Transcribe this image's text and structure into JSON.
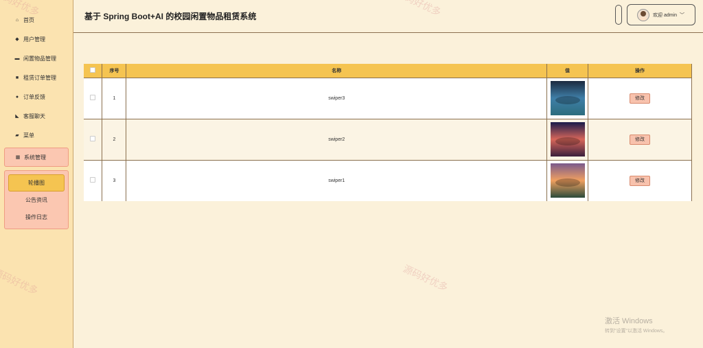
{
  "header": {
    "title": "基于 Spring Boot+AI 的校园闲置物品租赁系统",
    "welcome": "欢迎 admin"
  },
  "sidebar": {
    "items": [
      {
        "label": "首页",
        "icon": "home-icon"
      },
      {
        "label": "用户管理",
        "icon": "users-icon"
      },
      {
        "label": "闲置物品管理",
        "icon": "folder-icon"
      },
      {
        "label": "租赁订单管理",
        "icon": "print-icon"
      },
      {
        "label": "订单反馈",
        "icon": "circle-icon"
      },
      {
        "label": "客服聊天",
        "icon": "chat-icon"
      },
      {
        "label": "菜单",
        "icon": "inbox-icon"
      },
      {
        "label": "系统管理",
        "icon": "grid-icon"
      }
    ],
    "submenu": [
      "轮播图",
      "公告资讯",
      "操作日志"
    ]
  },
  "table": {
    "columns": [
      "序号",
      "名称",
      "值",
      "操作"
    ],
    "rows": [
      {
        "index": "1",
        "name": "swiper3",
        "action": "修改",
        "thumb_colors": [
          "#1c2a3f",
          "#3f7fa8",
          "#2c6d7e"
        ]
      },
      {
        "index": "2",
        "name": "swiper2",
        "action": "修改",
        "thumb_colors": [
          "#1a1c4a",
          "#d8665a",
          "#3a1f3c"
        ]
      },
      {
        "index": "3",
        "name": "swiper1",
        "action": "修改",
        "thumb_colors": [
          "#7a5a8c",
          "#f0a060",
          "#2a4a3a"
        ]
      }
    ]
  },
  "watermark": "源码好优多",
  "windows": {
    "line1": "激活 Windows",
    "line2": "转到\"设置\"以激活 Windows。"
  }
}
